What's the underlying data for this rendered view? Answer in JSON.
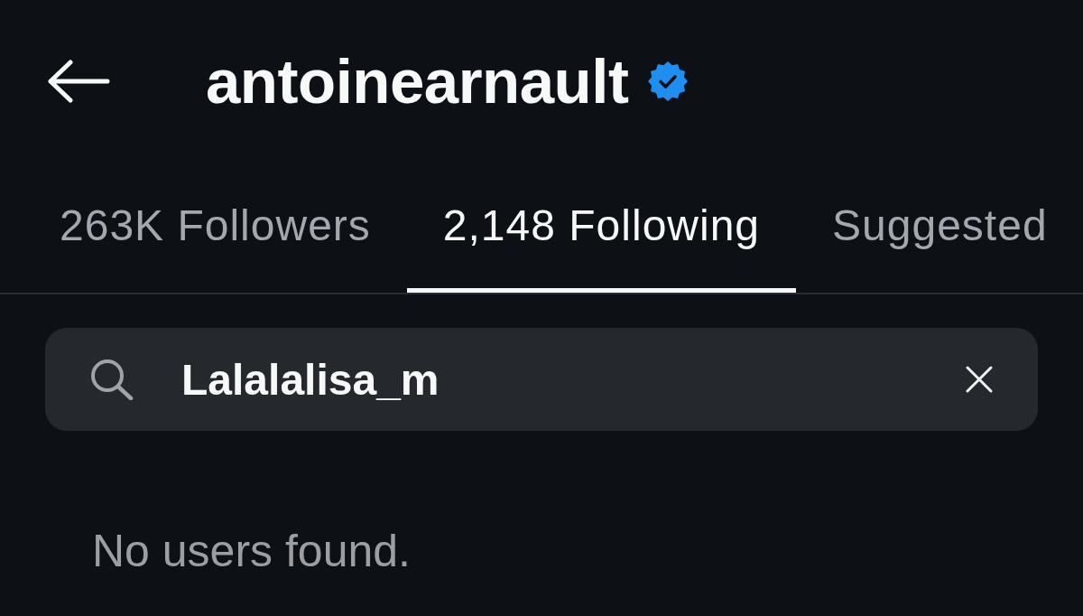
{
  "header": {
    "title": "antoinearnault",
    "verified": true
  },
  "tabs": [
    {
      "label": "263K Followers",
      "selected": false
    },
    {
      "label": "2,148 Following",
      "selected": true
    },
    {
      "label": "Suggested",
      "selected": false
    }
  ],
  "search": {
    "value": "Lalalalisa_m"
  },
  "results": {
    "message": "No users found."
  }
}
